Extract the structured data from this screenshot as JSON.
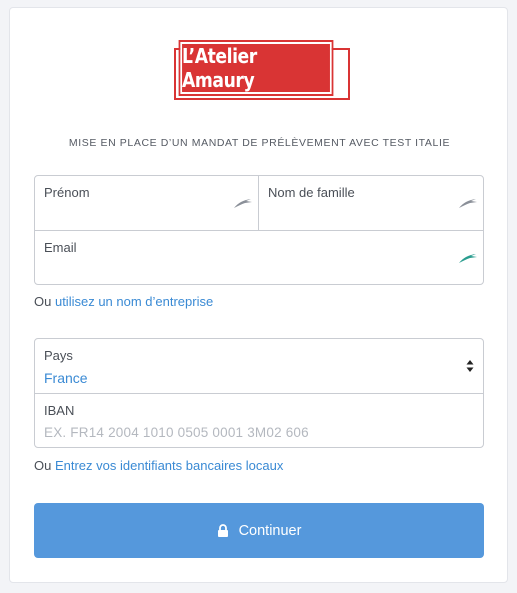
{
  "brand": {
    "logo_text": "L’Atelier Amaury",
    "color": "#d93434"
  },
  "subtitle": "MISE EN PLACE D’UN MANDAT DE PRÉLÈVEMENT AVEC TEST ITALIE",
  "identity": {
    "first_name_label": "Prénom",
    "last_name_label": "Nom de famille",
    "email_label": "Email",
    "autofill_icon": "autofill-bird-icon"
  },
  "company_link": {
    "prefix": "Ou",
    "link_text": "utilisez un nom d’entreprise"
  },
  "bank": {
    "country_label": "Pays",
    "country_value": "France",
    "iban_label": "IBAN",
    "iban_placeholder": "EX. FR14 2004 1010 0505 0001 3M02 606"
  },
  "local_link": {
    "prefix": "Ou",
    "link_text": "Entrez vos identifiants bancaires locaux"
  },
  "continue_button": {
    "label": "Continuer",
    "icon": "lock-icon",
    "color": "#5598dc"
  },
  "link_color": "#3a8ad4"
}
